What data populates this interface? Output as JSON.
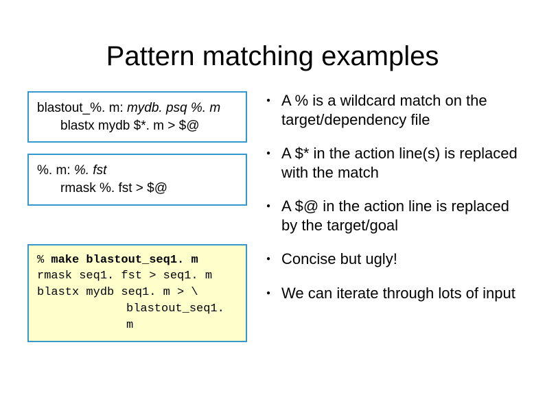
{
  "title": "Pattern matching examples",
  "box1": {
    "rule_target": "blastout_%. m:",
    "rule_deps": "mydb. psq %. m",
    "action": "blastx mydb $*. m > $@"
  },
  "box2": {
    "rule_target": "%. m:",
    "rule_deps": "%. fst",
    "action": "rmask %. fst > $@"
  },
  "box3": {
    "line1_prefix": "% ",
    "line1_cmd": "make blastout_seq1. m",
    "line2": "rmask seq1. fst > seq1. m",
    "line3": "blastx mydb seq1. m > \\",
    "line4": "blastout_seq1. m"
  },
  "bullets": [
    "A % is a wildcard match on the target/dependency file",
    "A $* in the action line(s) is replaced with the match",
    "A $@ in the action line is replaced by the target/goal",
    "Concise but ugly!",
    "We can iterate through lots of input"
  ]
}
